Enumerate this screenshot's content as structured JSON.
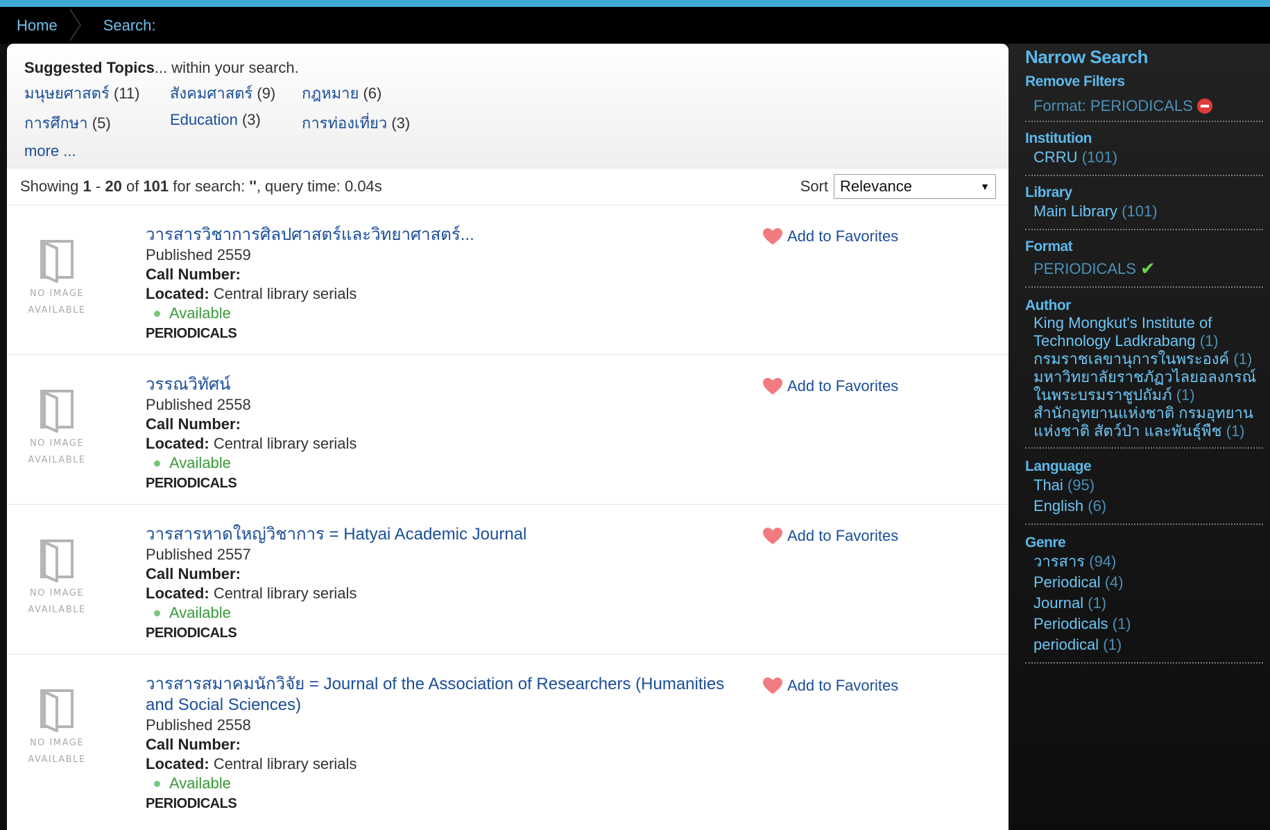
{
  "breadcrumb": {
    "home": "Home",
    "current": "Search:"
  },
  "topics": {
    "heading_bold": "Suggested Topics",
    "heading_rest": "... within your search.",
    "items": [
      {
        "name": "มนุษยศาสตร์",
        "count": "(11)"
      },
      {
        "name": "สังคมศาสตร์",
        "count": "(9)"
      },
      {
        "name": "กฎหมาย",
        "count": "(6)"
      },
      {
        "name": "การศึกษา",
        "count": "(5)"
      },
      {
        "name": "Education",
        "count": "(3)"
      },
      {
        "name": "การท่องเที่ยว",
        "count": "(3)"
      }
    ],
    "more": "more ..."
  },
  "results_header": {
    "showing": "Showing",
    "start": "1",
    "dash": "-",
    "end": "20",
    "of": "of",
    "total": "101",
    "for_search": "for search:",
    "query": "''",
    "query_time": ", query time: 0.04s",
    "sort_label": "Sort",
    "sort_value": "Relevance",
    "sort_arrow": "▼"
  },
  "labels": {
    "call_number": "Call Number:",
    "located": "Located:",
    "available": "Available",
    "add_fav": "Add to Favorites",
    "no_image_1": "NO IMAGE",
    "no_image_2": "AVAILABLE"
  },
  "results": [
    {
      "title": "วารสารวิชาการศิลปศาสตร์และวิทยาศาสตร์...",
      "published": "Published 2559",
      "location": "Central library serials",
      "format": "PERIODICALS"
    },
    {
      "title": "วรรณวิทัศน์",
      "published": "Published 2558",
      "location": "Central library serials",
      "format": "PERIODICALS"
    },
    {
      "title": "วารสารหาดใหญ่วิชาการ = Hatyai Academic Journal",
      "published": "Published 2557",
      "location": "Central library serials",
      "format": "PERIODICALS"
    },
    {
      "title": "วารสารสมาคมนักวิจัย = Journal of the Association of Researchers (Humanities and Social Sciences)",
      "published": "Published 2558",
      "location": "Central library serials",
      "format": "PERIODICALS"
    }
  ],
  "sidebar": {
    "title": "Narrow Search",
    "remove_filters": "Remove Filters",
    "applied_filter": "Format: PERIODICALS",
    "groups": [
      {
        "heading": "Institution",
        "items": [
          {
            "name": "CRRU",
            "count": "(101)"
          }
        ]
      },
      {
        "heading": "Library",
        "items": [
          {
            "name": "Main Library",
            "count": "(101)"
          }
        ]
      }
    ],
    "format_heading": "Format",
    "format_selected": "PERIODICALS",
    "groups2": [
      {
        "heading": "Author",
        "items": [
          {
            "name": "King Mongkut's Institute of Technology Ladkrabang",
            "count": "(1)"
          },
          {
            "name": "กรมราชเลขานุการในพระองค์",
            "count": "(1)"
          },
          {
            "name": "มหาวิทยาลัยราชภัฏวไลยอลงกรณ์ ในพระบรมราชูปถัมภ์",
            "count": "(1)"
          },
          {
            "name": "สำนักอุทยานแห่งชาติ กรมอุทยานแห่งชาติ สัตว์ป่า และพันธุ์พืช",
            "count": "(1)"
          }
        ]
      },
      {
        "heading": "Language",
        "items": [
          {
            "name": "Thai",
            "count": "(95)"
          },
          {
            "name": "English",
            "count": "(6)"
          }
        ]
      },
      {
        "heading": "Genre",
        "items": [
          {
            "name": "วารสาร",
            "count": "(94)"
          },
          {
            "name": "Periodical",
            "count": "(4)"
          },
          {
            "name": "Journal",
            "count": "(1)"
          },
          {
            "name": "Periodicals",
            "count": "(1)"
          },
          {
            "name": "periodical",
            "count": "(1)"
          }
        ]
      }
    ]
  }
}
